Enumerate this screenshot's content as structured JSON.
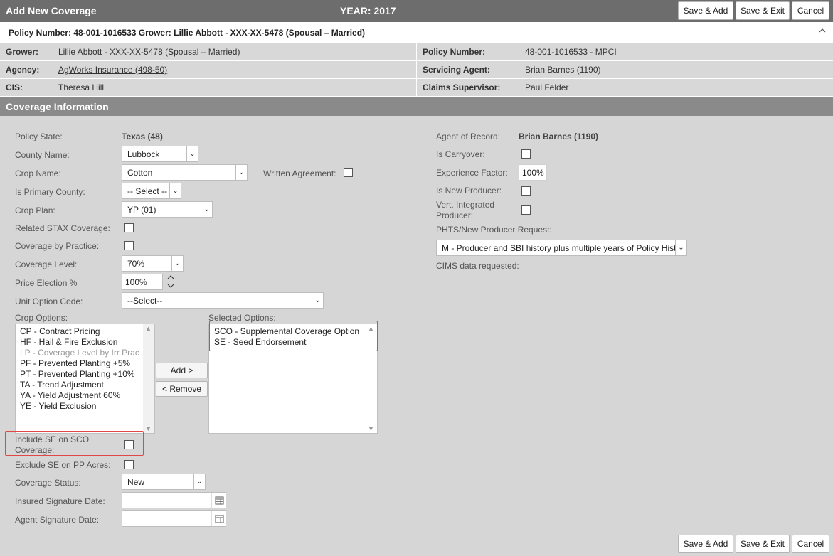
{
  "window": {
    "title": "Add New Coverage",
    "year": "YEAR: 2017",
    "buttons": {
      "save_add": "Save & Add",
      "save_exit": "Save & Exit",
      "cancel": "Cancel"
    }
  },
  "policy_bar": {
    "text": "Policy Number: 48-001-1016533 Grower: Lillie Abbott - XXX-XX-5478 (Spousal – Married)",
    "chevron": "^"
  },
  "info": {
    "grower_label": "Grower:",
    "grower_value": "Lillie Abbott - XXX-XX-5478 (Spousal – Married)",
    "agency_label": "Agency:",
    "agency_value": "AgWorks Insurance (498-50)",
    "cis_label": "CIS:",
    "cis_value": "Theresa Hill",
    "policy_number_label": "Policy Number:",
    "policy_number_value": "48-001-1016533 - MPCI",
    "servicing_agent_label": "Servicing Agent:",
    "servicing_agent_value": "Brian Barnes (1190)",
    "claims_supervisor_label": "Claims Supervisor:",
    "claims_supervisor_value": "Paul Felder"
  },
  "section": {
    "title": "Coverage Information"
  },
  "form": {
    "policy_state_label": "Policy State:",
    "policy_state_value": "Texas (48)",
    "county_label": "County Name:",
    "county_value": "Lubbock",
    "crop_label": "Crop Name:",
    "crop_value": "Cotton",
    "written_agreement_label": "Written Agreement:",
    "primary_county_label": "Is Primary County:",
    "primary_county_value": "-- Select --",
    "crop_plan_label": "Crop Plan:",
    "crop_plan_value": "YP (01)",
    "related_stax_label": "Related STAX Coverage:",
    "coverage_by_practice_label": "Coverage by Practice:",
    "coverage_level_label": "Coverage Level:",
    "coverage_level_value": "70%",
    "price_election_label": "Price Election %",
    "price_election_value": "100%",
    "unit_option_label": "Unit Option Code:",
    "unit_option_value": "--Select--",
    "crop_options_label": "Crop Options:",
    "selected_options_label": "Selected Options:",
    "crop_options": [
      {
        "text": "CP - Contract Pricing",
        "disabled": false
      },
      {
        "text": "HF - Hail & Fire Exclusion",
        "disabled": false
      },
      {
        "text": "LP - Coverage Level by Irr Prac",
        "disabled": true
      },
      {
        "text": "PF - Prevented Planting +5%",
        "disabled": false
      },
      {
        "text": "PT - Prevented Planting +10%",
        "disabled": false
      },
      {
        "text": "TA - Trend Adjustment",
        "disabled": false
      },
      {
        "text": "YA - Yield Adjustment 60%",
        "disabled": false
      },
      {
        "text": "YE - Yield Exclusion",
        "disabled": false
      }
    ],
    "selected_options": [
      {
        "text": "SCO - Supplemental Coverage Option"
      },
      {
        "text": "SE - Seed Endorsement"
      }
    ],
    "add_button": "Add >",
    "remove_button": "< Remove",
    "include_se_label_1": "Include SE on SCO",
    "include_se_label_2": "Coverage:",
    "exclude_se_label": "Exclude SE on PP Acres:",
    "coverage_status_label": "Coverage Status:",
    "coverage_status_value": "New",
    "insured_sig_label": "Insured Signature Date:",
    "agent_sig_label": "Agent Signature Date:",
    "agent_of_record_label": "Agent of Record:",
    "agent_of_record_value": "Brian Barnes (1190)",
    "carryover_label": "Is Carryover:",
    "experience_factor_label": "Experience Factor:",
    "experience_factor_value": "100%",
    "new_producer_label": "Is New Producer:",
    "vert_label_1": "Vert. Integrated",
    "vert_label_2": "Producer:",
    "phts_label": "PHTS/New Producer Request:",
    "phts_value": "M - Producer and SBI history plus multiple years of Policy History",
    "cims_label": "CIMS data requested:"
  },
  "icons": {
    "dropdown": "chevron-down-icon",
    "calendar": "calendar-icon",
    "spinner": "spinner-icon"
  }
}
